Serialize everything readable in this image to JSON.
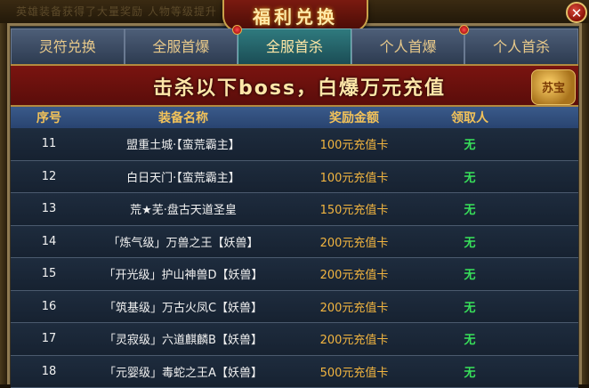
{
  "window": {
    "title": "福利兑换",
    "close_symbol": "✕",
    "background_text": "英雄装备获得了大量奖励 人物等级提升"
  },
  "tabs": [
    {
      "label": "灵符兑换",
      "active": false
    },
    {
      "label": "全服首爆",
      "active": false
    },
    {
      "label": "全服首杀",
      "active": true
    },
    {
      "label": "个人首爆",
      "active": false
    },
    {
      "label": "个人首杀",
      "active": false
    }
  ],
  "banner": {
    "text": "击杀以下boss，白爆万元充值",
    "deco_text": "苏宝"
  },
  "table": {
    "headers": {
      "no": "序号",
      "name": "装备名称",
      "reward": "奖励金额",
      "claimer": "领取人"
    },
    "rows": [
      {
        "no": "11",
        "name": "盟重土城·【蛮荒霸主】",
        "reward": "100元充值卡",
        "claimer": "无"
      },
      {
        "no": "12",
        "name": "白日天门·【蛮荒霸主】",
        "reward": "100元充值卡",
        "claimer": "无"
      },
      {
        "no": "13",
        "name": "荒★芜·盘古天道圣皇",
        "reward": "150元充值卡",
        "claimer": "无"
      },
      {
        "no": "14",
        "name": "「炼气级」万兽之王【妖兽】",
        "reward": "200元充值卡",
        "claimer": "无"
      },
      {
        "no": "15",
        "name": "「开光级」护山神兽D【妖兽】",
        "reward": "200元充值卡",
        "claimer": "无"
      },
      {
        "no": "16",
        "name": "「筑基级」万古火凤C【妖兽】",
        "reward": "200元充值卡",
        "claimer": "无"
      },
      {
        "no": "17",
        "name": "「灵寂级」六道麒麟B【妖兽】",
        "reward": "200元充值卡",
        "claimer": "无"
      },
      {
        "no": "18",
        "name": "「元婴级」毒蛇之王A【妖兽】",
        "reward": "500元充值卡",
        "claimer": "无"
      }
    ]
  },
  "colors": {
    "accent_gold": "#f2c25a",
    "reward_orange": "#f2b540",
    "claim_green": "#38e05a",
    "active_tab": "#2f7a7e",
    "banner_red": "#7a1410"
  }
}
